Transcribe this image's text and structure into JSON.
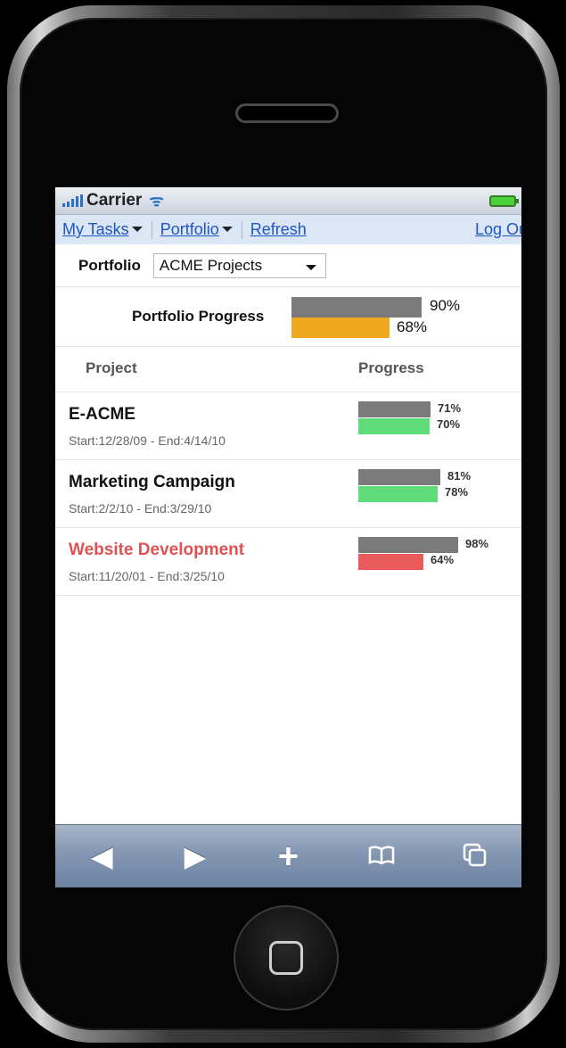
{
  "status_bar": {
    "carrier": "Carrier"
  },
  "nav": {
    "my_tasks": "My Tasks",
    "portfolio": "Portfolio",
    "refresh": "Refresh",
    "logout": "Log Out"
  },
  "portfolio_selector": {
    "label": "Portfolio",
    "selected": "ACME Projects"
  },
  "portfolio_progress": {
    "title": "Portfolio Progress",
    "planned": 0.9,
    "planned_label": "90%",
    "actual": 0.68,
    "actual_label": "68%",
    "actual_color": "#f0a820"
  },
  "table": {
    "headers": {
      "project": "Project",
      "progress": "Progress"
    },
    "rows": [
      {
        "name": "E-ACME",
        "dates": "Start:12/28/09  -  End:4/14/10",
        "planned": 0.71,
        "planned_label": "71%",
        "actual": 0.7,
        "actual_label": "70%",
        "status_color": "#5fdc7a",
        "late": false
      },
      {
        "name": "Marketing Campaign",
        "dates": "Start:2/2/10  -  End:3/29/10",
        "planned": 0.81,
        "planned_label": "81%",
        "actual": 0.78,
        "actual_label": "78%",
        "status_color": "#5fdc7a",
        "late": false
      },
      {
        "name": "Website Development",
        "dates": "Start:11/20/01  -  End:3/25/10",
        "planned": 0.98,
        "planned_label": "98%",
        "actual": 0.64,
        "actual_label": "64%",
        "status_color": "#ea5a5a",
        "late": true
      }
    ]
  },
  "toolbar": {
    "icons": [
      "back-arrow-icon",
      "forward-arrow-icon",
      "plus-icon",
      "bookmarks-icon",
      "pages-icon"
    ]
  },
  "colors": {
    "planned_bar": "#7a7a7a",
    "link": "#1f55c4"
  }
}
